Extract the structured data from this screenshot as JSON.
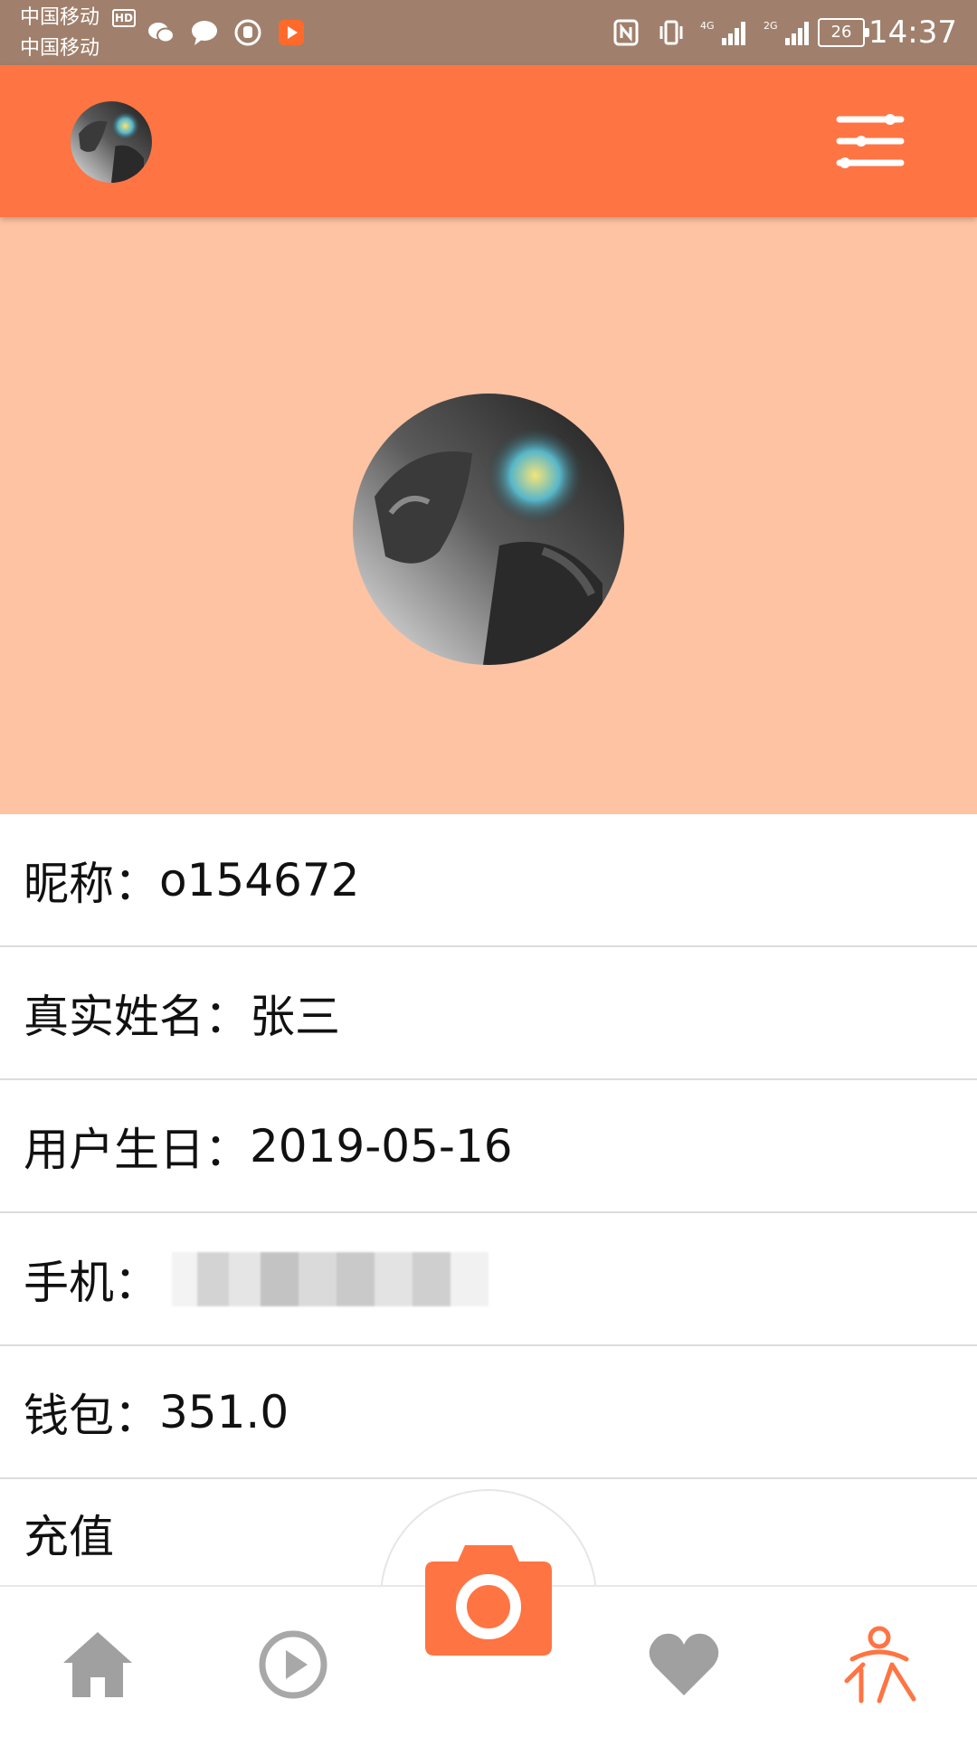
{
  "status_bar": {
    "carrier_1": "中国移动",
    "carrier_2": "中国移动",
    "hd_badge": "HD",
    "network_1": "4G",
    "network_2": "2G",
    "battery": "26",
    "time": "14:37",
    "icons": [
      "wechat-icon",
      "message-icon",
      "hand-icon",
      "video-app-icon",
      "nfc-icon",
      "vibrate-icon",
      "signal-4g-icon",
      "signal-2g-icon",
      "battery-icon"
    ]
  },
  "app_bar": {
    "icons": [
      "avatar",
      "filter-settings-icon"
    ],
    "color": "#ff7443"
  },
  "profile": {
    "header_color": "#fdc3a3"
  },
  "info": {
    "nickname_label": "昵称：",
    "nickname_value": "o154672",
    "real_name_label": "真实姓名：",
    "real_name_value": "张三",
    "birthday_label": "用户生日：",
    "birthday_value": "2019-05-16",
    "phone_label": "手机：",
    "wallet_label": "钱包：",
    "wallet_value": "351.0",
    "recharge_label": "充值"
  },
  "bottom_nav": {
    "items": [
      "home-icon",
      "play-icon",
      "camera-icon",
      "heart-icon",
      "profile-icon"
    ],
    "active": "profile-icon",
    "active_color": "#ff7443",
    "inactive_color": "#a0a0a0"
  }
}
